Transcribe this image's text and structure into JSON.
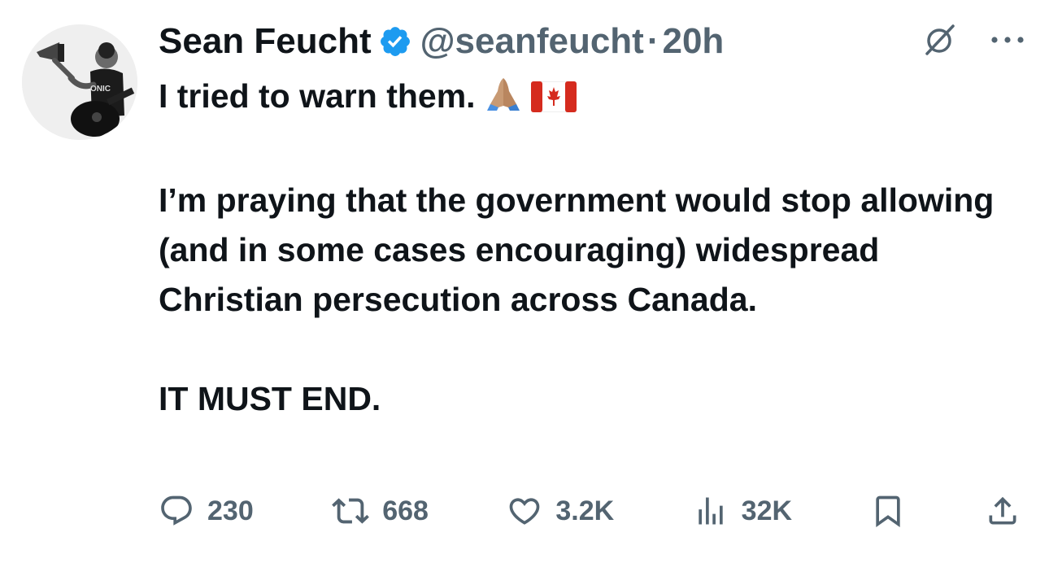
{
  "author": {
    "name": "Sean Feucht",
    "handle": "@seanfeucht",
    "separator": "·",
    "time": "20h",
    "verified": true,
    "avatar_icon": "avatar-photo",
    "avatar_shirt_text": "ONIC"
  },
  "tweet": {
    "line1": "I tried to warn them.",
    "line1_emojis": [
      "folded-hands-emoji",
      "canada-flag-emoji"
    ],
    "paragraph2": "I’m praying that the government would stop allowing (and in some cases encouraging) widespread Christian persecution across Canada.",
    "paragraph3": "IT MUST END."
  },
  "metrics": {
    "replies": "230",
    "reposts": "668",
    "likes": "3.2K",
    "views": "32K"
  },
  "colors": {
    "text": "#0f1419",
    "secondary": "#536471",
    "verified_badge": "#1d9bf0",
    "canada_red": "#d52b1e"
  },
  "icons": {
    "top": [
      "grok-icon",
      "more-icon"
    ],
    "actions": [
      "reply-icon",
      "repost-icon",
      "like-icon",
      "views-icon",
      "bookmark-icon",
      "share-icon"
    ]
  }
}
